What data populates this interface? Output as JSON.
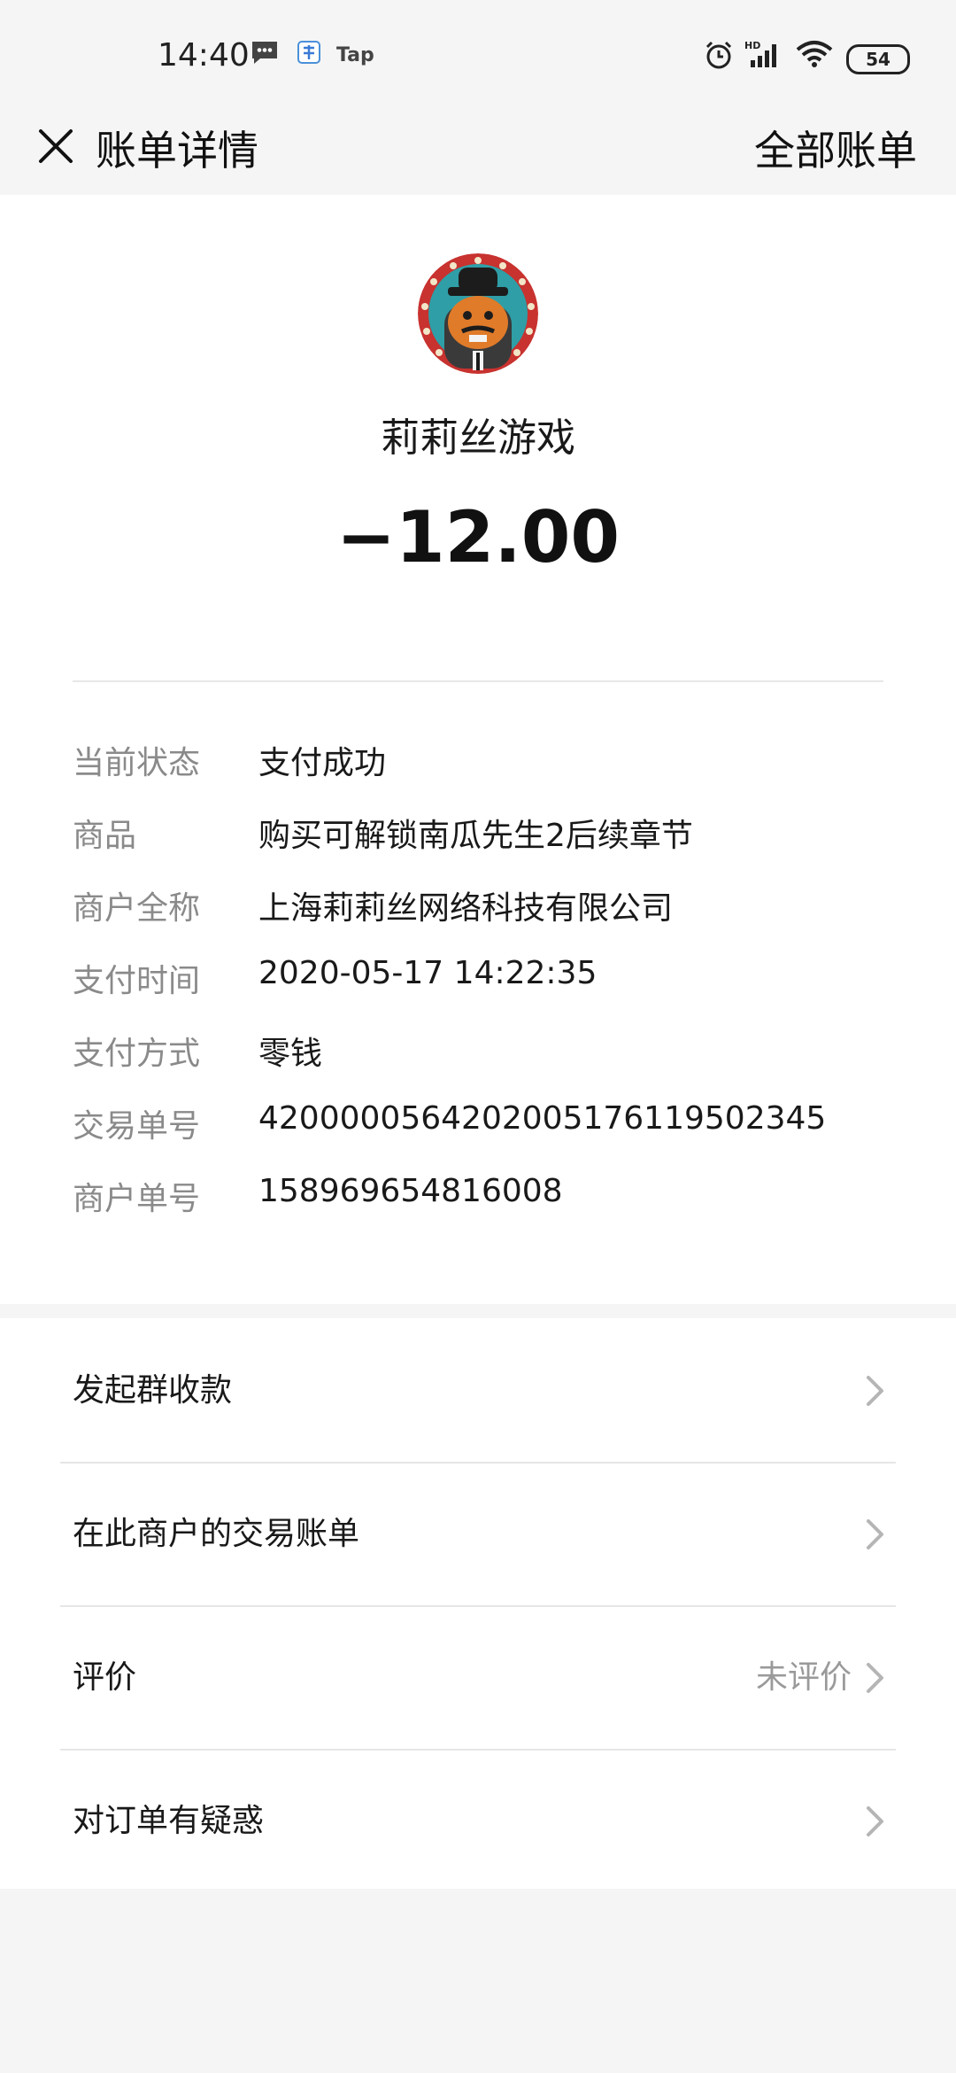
{
  "status_bar": {
    "time": "14:40",
    "app_label": "Tap",
    "battery": "54"
  },
  "header": {
    "title": "账单详情",
    "right_link": "全部账单"
  },
  "merchant": {
    "name": "莉莉丝游戏",
    "amount": "−12.00"
  },
  "details": [
    {
      "label": "当前状态",
      "value": "支付成功"
    },
    {
      "label": "商品",
      "value": "购买可解锁南瓜先生2后续章节"
    },
    {
      "label": "商户全称",
      "value": "上海莉莉丝网络科技有限公司"
    },
    {
      "label": "支付时间",
      "value": "2020-05-17 14:22:35"
    },
    {
      "label": "支付方式",
      "value": "零钱"
    },
    {
      "label": "交易单号",
      "value": "4200000564202005176119502345"
    },
    {
      "label": "商户单号",
      "value": "158969654816008"
    }
  ],
  "actions": [
    {
      "label": "发起群收款",
      "note": ""
    },
    {
      "label": "在此商户的交易账单",
      "note": ""
    },
    {
      "label": "评价",
      "note": "未评价"
    },
    {
      "label": "对订单有疑惑",
      "note": ""
    }
  ],
  "colors": {
    "background": "#f5f5f5",
    "card": "#ffffff",
    "label_gray": "#8a8a8a",
    "text": "#191919"
  }
}
